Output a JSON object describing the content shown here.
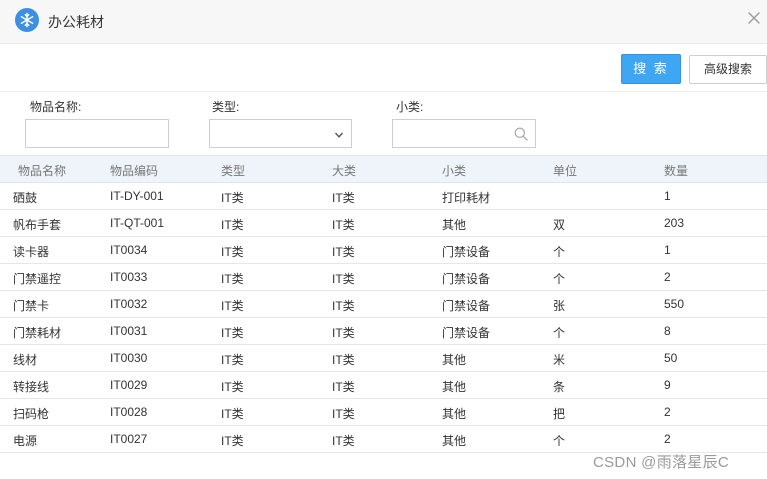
{
  "window": {
    "title": "办公耗材",
    "icon": "snowflake-icon",
    "close_icon": "close-icon"
  },
  "toolbar": {
    "search_label": "搜 索",
    "advanced_search_label": "高级搜索"
  },
  "filters": [
    {
      "label": "物品名称:",
      "value": "",
      "type": "text"
    },
    {
      "label": "类型:",
      "value": "",
      "type": "select",
      "icon": "chevron-down-icon"
    },
    {
      "label": "小类:",
      "value": "",
      "type": "search",
      "icon": "search-icon"
    }
  ],
  "table": {
    "columns": [
      "物品名称",
      "物品编码",
      "类型",
      "大类",
      "小类",
      "单位",
      "数量"
    ],
    "rows": [
      [
        "硒鼓",
        "IT-DY-001",
        "IT类",
        "IT类",
        "打印耗材",
        "",
        "1"
      ],
      [
        "帆布手套",
        "IT-QT-001",
        "IT类",
        "IT类",
        "其他",
        "双",
        "203"
      ],
      [
        "读卡器",
        "IT0034",
        "IT类",
        "IT类",
        "门禁设备",
        "个",
        "1"
      ],
      [
        "门禁遥控",
        "IT0033",
        "IT类",
        "IT类",
        "门禁设备",
        "个",
        "2"
      ],
      [
        "门禁卡",
        "IT0032",
        "IT类",
        "IT类",
        "门禁设备",
        "张",
        "550"
      ],
      [
        "门禁耗材",
        "IT0031",
        "IT类",
        "IT类",
        "门禁设备",
        "个",
        "8"
      ],
      [
        "线材",
        "IT0030",
        "IT类",
        "IT类",
        "其他",
        "米",
        "50"
      ],
      [
        "转接线",
        "IT0029",
        "IT类",
        "IT类",
        "其他",
        "条",
        "9"
      ],
      [
        "扫码枪",
        "IT0028",
        "IT类",
        "IT类",
        "其他",
        "把",
        "2"
      ],
      [
        "电源",
        "IT0027",
        "IT类",
        "IT类",
        "其他",
        "个",
        "2"
      ]
    ]
  },
  "watermark": "CSDN @雨落星辰C",
  "colors": {
    "accent": "#3ea6f2",
    "icon_bg": "#3c8fe3",
    "header_bg": "#eef4fa"
  }
}
